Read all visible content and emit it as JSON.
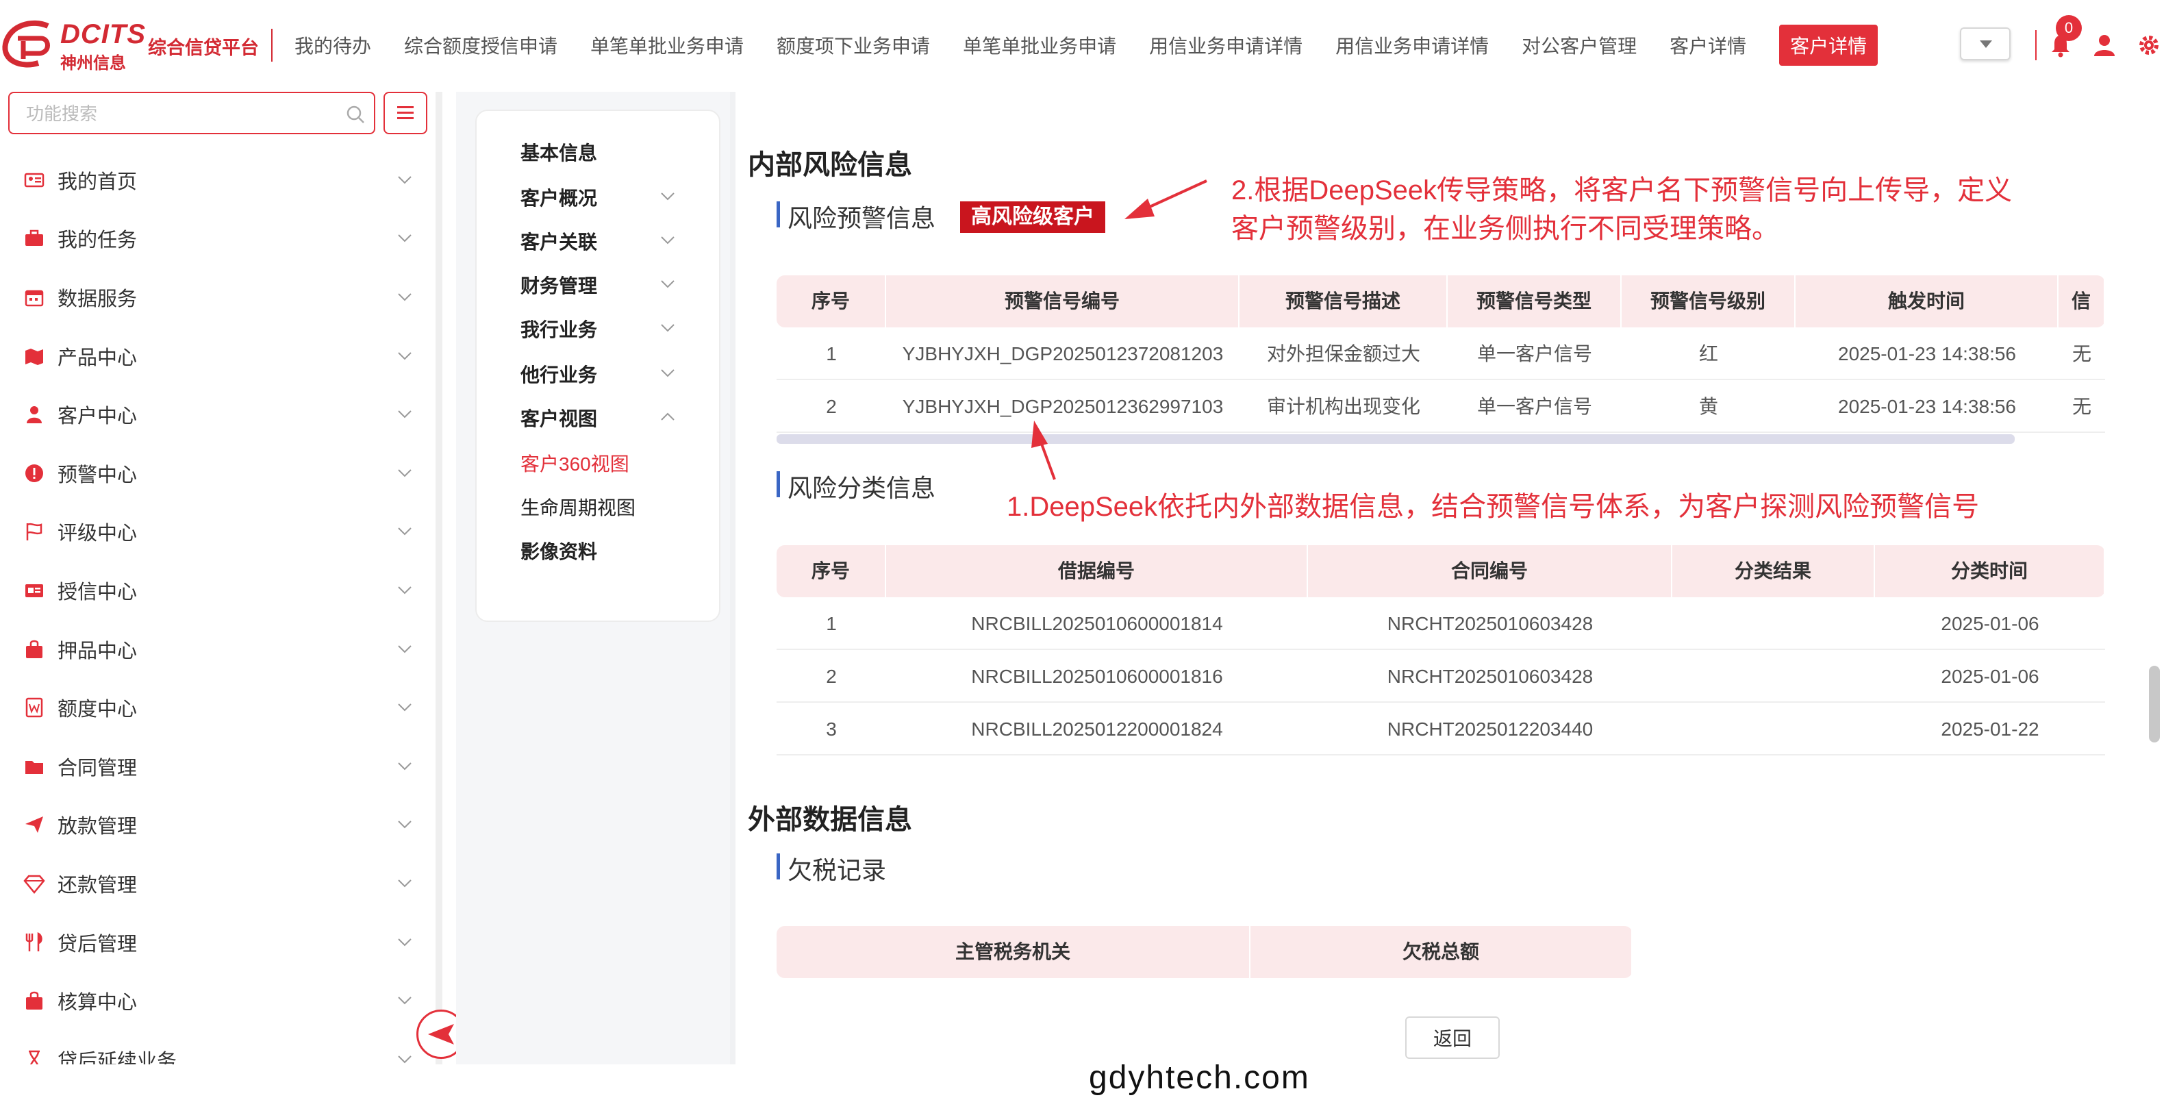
{
  "brand": {
    "name": "DCITS",
    "sub": "神州信息",
    "platform": "综合信贷平台"
  },
  "nav": {
    "items": [
      "我的待办",
      "综合额度授信申请",
      "单笔单批业务申请",
      "额度项下业务申请",
      "单笔单批业务申请",
      "用信业务申请详情",
      "用信业务申请详情",
      "对公客户管理",
      "客户详情"
    ],
    "active": "客户详情",
    "notification_count": "0"
  },
  "sidebar": {
    "search_placeholder": "功能搜索",
    "items": [
      {
        "label": "我的首页",
        "icon": "id-card-icon"
      },
      {
        "label": "我的任务",
        "icon": "briefcase-icon"
      },
      {
        "label": "数据服务",
        "icon": "calendar-icon"
      },
      {
        "label": "产品中心",
        "icon": "map-icon"
      },
      {
        "label": "客户中心",
        "icon": "user-icon"
      },
      {
        "label": "预警中心",
        "icon": "alert-icon"
      },
      {
        "label": "评级中心",
        "icon": "flag-icon"
      },
      {
        "label": "授信中心",
        "icon": "card-icon"
      },
      {
        "label": "押品中心",
        "icon": "bag-icon"
      },
      {
        "label": "额度中心",
        "icon": "word-icon"
      },
      {
        "label": "合同管理",
        "icon": "folder-icon"
      },
      {
        "label": "放款管理",
        "icon": "send-icon"
      },
      {
        "label": "还款管理",
        "icon": "diamond-icon"
      },
      {
        "label": "贷后管理",
        "icon": "cutlery-icon"
      },
      {
        "label": "核算中心",
        "icon": "bag-icon"
      },
      {
        "label": "贷后延续业务",
        "icon": "hourglass-icon"
      }
    ]
  },
  "subnav": {
    "items": [
      {
        "label": "基本信息",
        "type": "top"
      },
      {
        "label": "客户概况",
        "type": "top",
        "chevron": "down"
      },
      {
        "label": "客户关联",
        "type": "top",
        "chevron": "down"
      },
      {
        "label": "财务管理",
        "type": "top",
        "chevron": "down"
      },
      {
        "label": "我行业务",
        "type": "top",
        "chevron": "down"
      },
      {
        "label": "他行业务",
        "type": "top",
        "chevron": "down"
      },
      {
        "label": "客户视图",
        "type": "top",
        "chevron": "up"
      },
      {
        "label": "客户360视图",
        "type": "active"
      },
      {
        "label": "生命周期视图",
        "type": "sub"
      },
      {
        "label": "影像资料",
        "type": "top"
      }
    ]
  },
  "main": {
    "internal_title": "内部风险信息",
    "warning_title": "风险预警信息",
    "risk_tag": "高风险级客户",
    "warning_table": {
      "headers": [
        "序号",
        "预警信号编号",
        "预警信号描述",
        "预警信号类型",
        "预警信号级别",
        "触发时间",
        "信"
      ],
      "rows": [
        [
          "1",
          "YJBHYJXH_DGP2025012372081203",
          "对外担保金额过大",
          "单一客户信号",
          "红",
          "2025-01-23 14:38:56",
          "无"
        ],
        [
          "2",
          "YJBHYJXH_DGP2025012362997103",
          "审计机构出现变化",
          "单一客户信号",
          "黄",
          "2025-01-23 14:38:56",
          "无"
        ]
      ]
    },
    "classify_title": "风险分类信息",
    "classify_table": {
      "headers": [
        "序号",
        "借据编号",
        "合同编号",
        "分类结果",
        "分类时间"
      ],
      "rows": [
        [
          "1",
          "NRCBILL2025010600001814",
          "NRCHT2025010603428",
          "",
          "2025-01-06"
        ],
        [
          "2",
          "NRCBILL2025010600001816",
          "NRCHT2025010603428",
          "",
          "2025-01-06"
        ],
        [
          "3",
          "NRCBILL2025012200001824",
          "NRCHT2025012203440",
          "",
          "2025-01-22"
        ]
      ]
    },
    "external_title": "外部数据信息",
    "tax_title": "欠税记录",
    "tax_table": {
      "headers": [
        "主管税务机关",
        "欠税总额"
      ]
    },
    "back_label": "返回"
  },
  "annotations": {
    "a1": "1.DeepSeek依托内外部数据信息，结合预警信号体系，为客户探测风险预警信号",
    "a2_line1": "2.根据DeepSeek传导策略，将客户名下预警信号向上传导，定义",
    "a2_line2": "客户预警级别，在业务侧执行不同受理策略。"
  },
  "watermark": "gdyhtech.com",
  "colors": {
    "accent": "#e3303a",
    "header_bg": "#fbe9ea",
    "title_bar": "#3a66c4",
    "tag_bg": "#c9151e"
  }
}
